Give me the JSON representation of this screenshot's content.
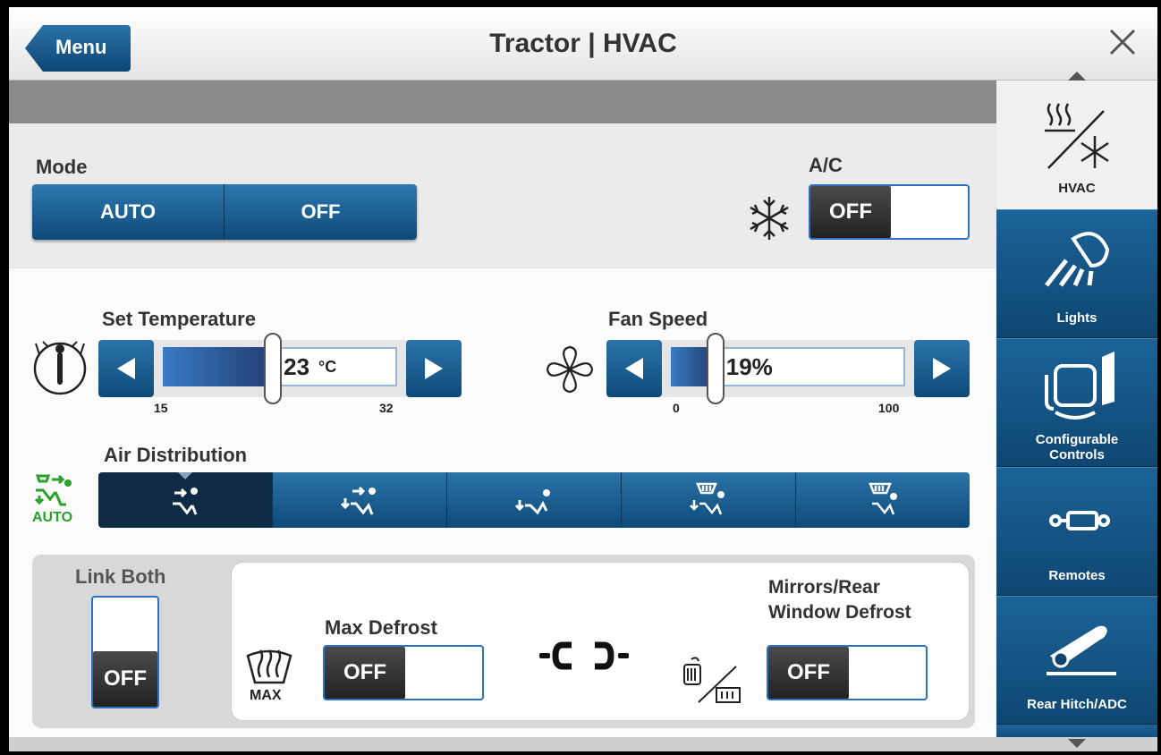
{
  "header": {
    "menu_label": "Menu",
    "title": "Tractor | HVAC"
  },
  "mode": {
    "label": "Mode",
    "options": [
      "AUTO",
      "OFF"
    ]
  },
  "ac": {
    "label": "A/C",
    "state": "OFF"
  },
  "set_temperature": {
    "label": "Set Temperature",
    "value": "23",
    "unit": "°C",
    "min": "15",
    "max": "32",
    "fraction": 0.47
  },
  "fan_speed": {
    "label": "Fan Speed",
    "value": "19%",
    "min": "0",
    "max": "100",
    "fraction": 0.19
  },
  "air_distribution": {
    "label": "Air Distribution",
    "auto_label": "AUTO",
    "selected_index": 0
  },
  "link_both": {
    "label": "Link Both",
    "state": "OFF"
  },
  "max_defrost": {
    "label": "Max Defrost",
    "icon_label": "MAX",
    "state": "OFF"
  },
  "mirrors_defrost": {
    "label_line1": "Mirrors/Rear",
    "label_line2": "Window Defrost",
    "state": "OFF"
  },
  "nav": {
    "items": [
      {
        "label": "HVAC",
        "icon": "hvac-icon"
      },
      {
        "label": "Lights",
        "icon": "lights-icon"
      },
      {
        "label_line1": "Configurable",
        "label_line2": "Controls",
        "icon": "configurable-controls-icon"
      },
      {
        "label": "Remotes",
        "icon": "remotes-icon"
      },
      {
        "label": "Rear Hitch/ADC",
        "icon": "rear-hitch-icon"
      }
    ]
  },
  "colors": {
    "accent_blue": "#0e4a7a",
    "toggle_border": "#2b73c2",
    "auto_green": "#2aa22a"
  }
}
